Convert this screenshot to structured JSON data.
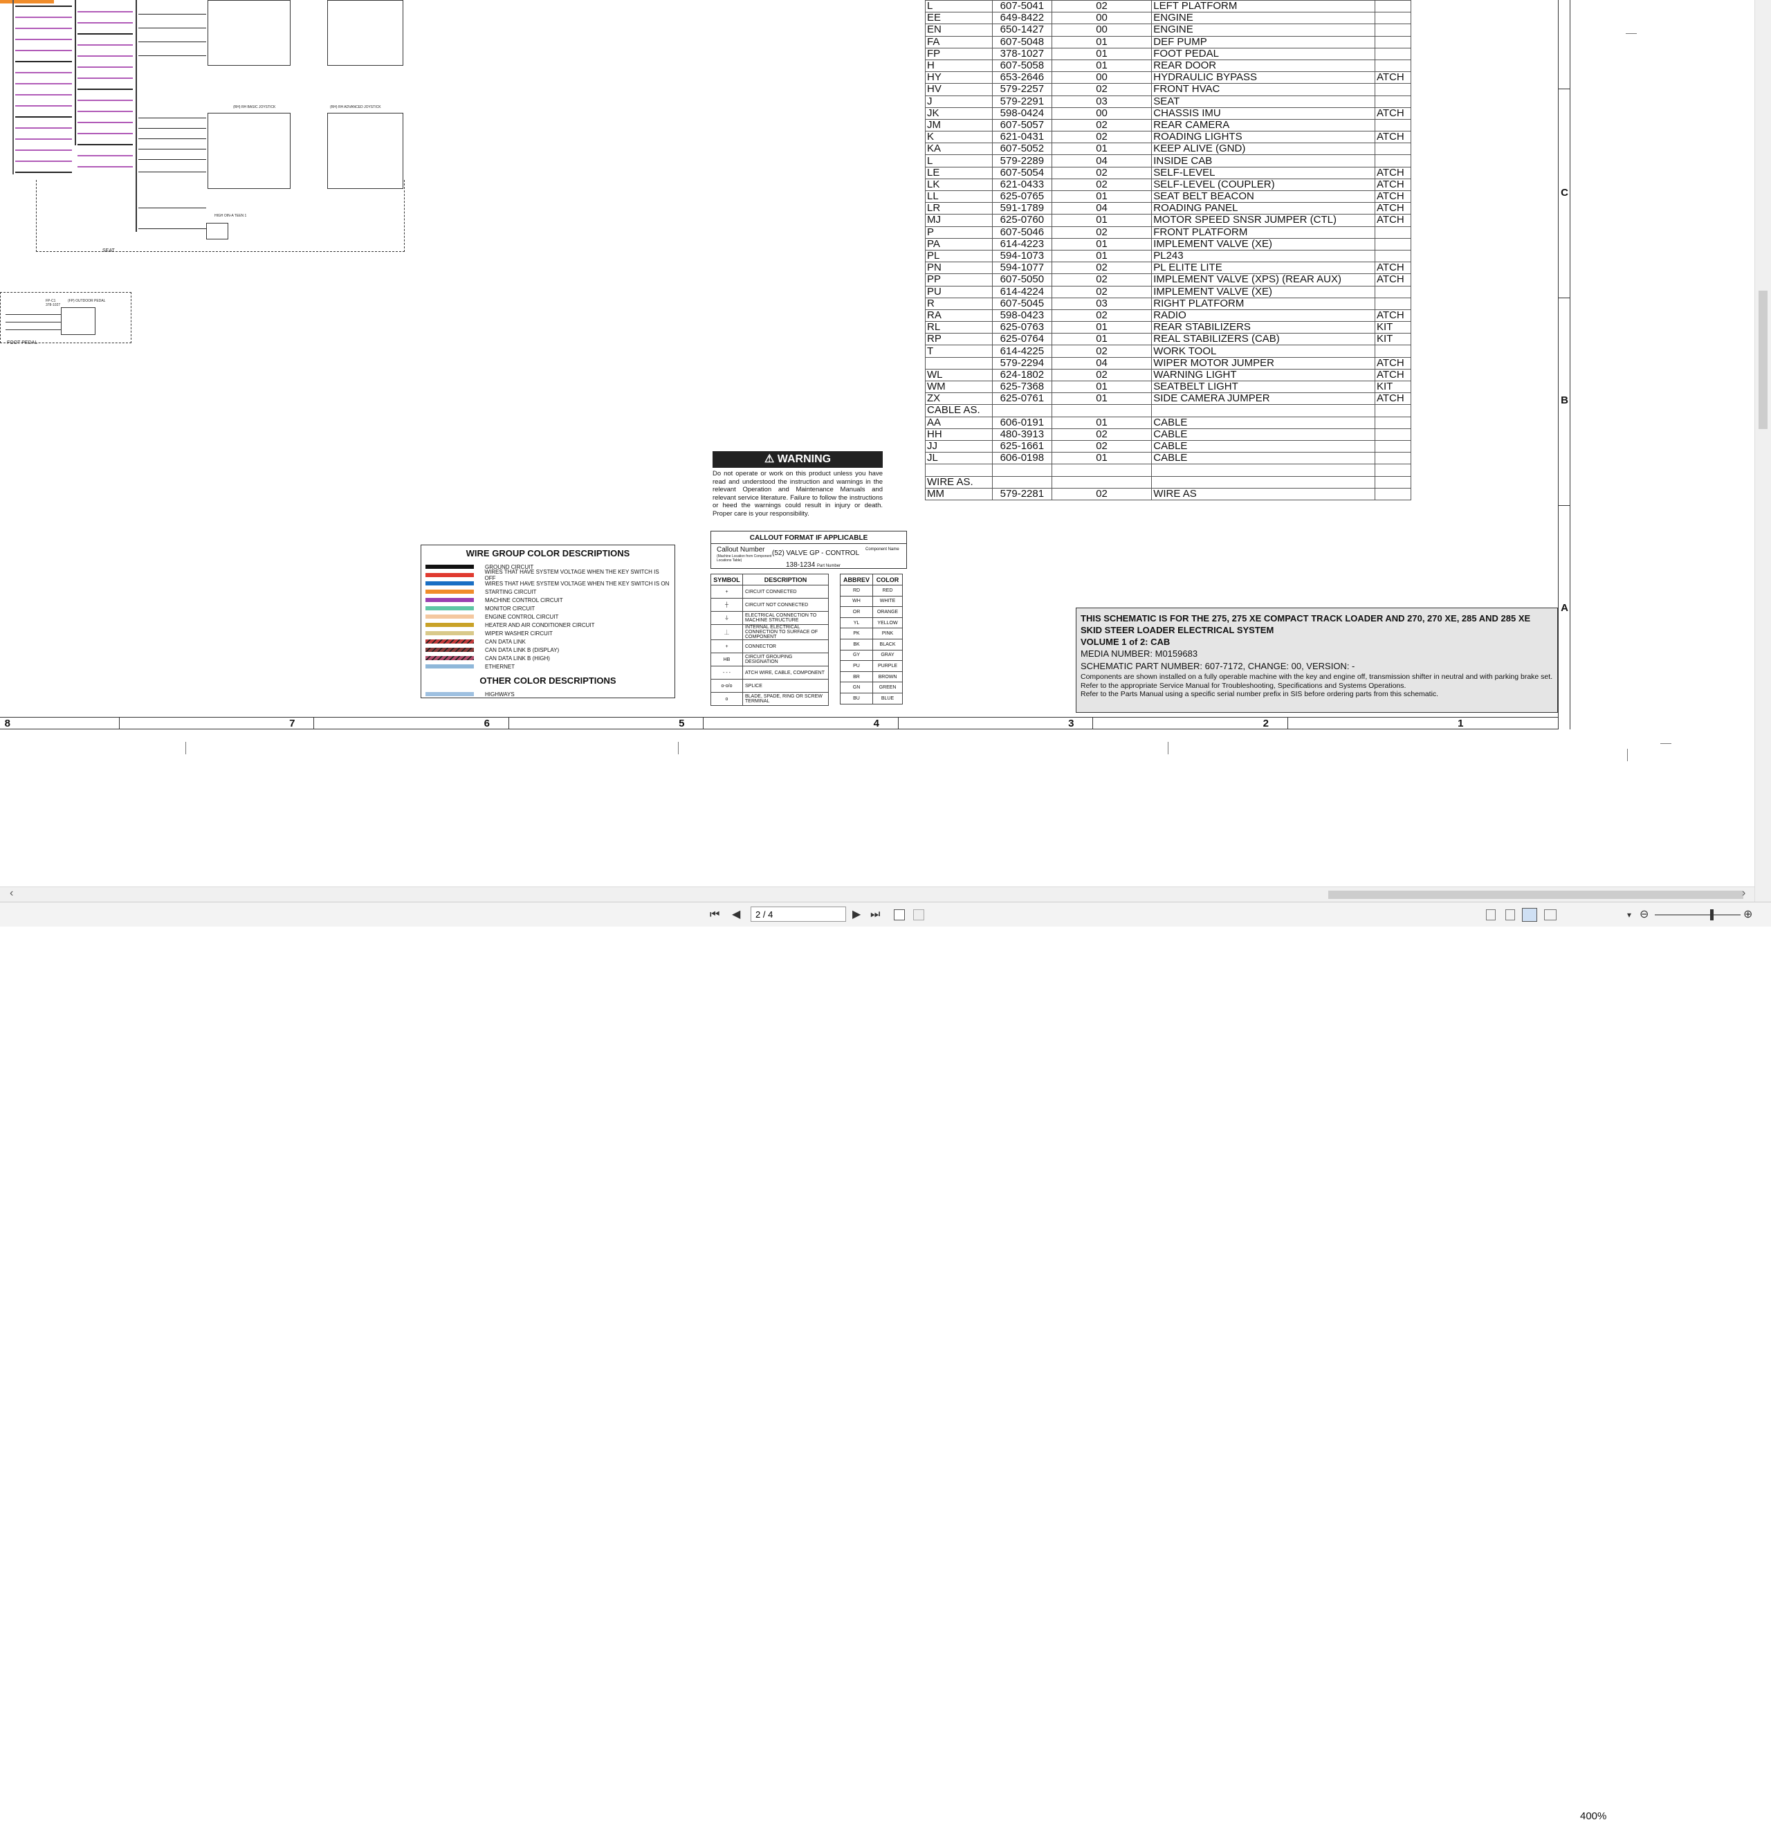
{
  "connector_table": {
    "rows": [
      [
        "L",
        "607-5041",
        "02",
        "LEFT PLATFORM",
        ""
      ],
      [
        "EE",
        "649-8422",
        "00",
        "ENGINE",
        ""
      ],
      [
        "EN",
        "650-1427",
        "00",
        "ENGINE",
        ""
      ],
      [
        "FA",
        "607-5048",
        "01",
        "DEF PUMP",
        ""
      ],
      [
        "FP",
        "378-1027",
        "01",
        "FOOT PEDAL",
        ""
      ],
      [
        "H",
        "607-5058",
        "01",
        "REAR DOOR",
        ""
      ],
      [
        "HY",
        "653-2646",
        "00",
        "HYDRAULIC BYPASS",
        "ATCH"
      ],
      [
        "HV",
        "579-2257",
        "02",
        "FRONT HVAC",
        ""
      ],
      [
        "J",
        "579-2291",
        "03",
        "SEAT",
        ""
      ],
      [
        "JK",
        "598-0424",
        "00",
        "CHASSIS IMU",
        "ATCH"
      ],
      [
        "JM",
        "607-5057",
        "02",
        "REAR CAMERA",
        ""
      ],
      [
        "K",
        "621-0431",
        "02",
        "ROADING LIGHTS",
        "ATCH"
      ],
      [
        "KA",
        "607-5052",
        "01",
        "KEEP ALIVE (GND)",
        ""
      ],
      [
        "L",
        "579-2289",
        "04",
        "INSIDE CAB",
        ""
      ],
      [
        "LE",
        "607-5054",
        "02",
        "SELF-LEVEL",
        "ATCH"
      ],
      [
        "LK",
        "621-0433",
        "02",
        "SELF-LEVEL (COUPLER)",
        "ATCH"
      ],
      [
        "LL",
        "625-0765",
        "01",
        "SEAT BELT BEACON",
        "ATCH"
      ],
      [
        "LR",
        "591-1789",
        "04",
        "ROADING PANEL",
        "ATCH"
      ],
      [
        "MJ",
        "625-0760",
        "01",
        "MOTOR SPEED SNSR JUMPER (CTL)",
        "ATCH"
      ],
      [
        "P",
        "607-5046",
        "02",
        "FRONT PLATFORM",
        ""
      ],
      [
        "PA",
        "614-4223",
        "01",
        "IMPLEMENT VALVE (XE)",
        ""
      ],
      [
        "PL",
        "594-1073",
        "01",
        "PL243",
        ""
      ],
      [
        "PN",
        "594-1077",
        "02",
        "PL ELITE LITE",
        "ATCH"
      ],
      [
        "PP",
        "607-5050",
        "02",
        "IMPLEMENT VALVE (XPS) (REAR AUX)",
        "ATCH"
      ],
      [
        "PU",
        "614-4224",
        "02",
        "IMPLEMENT VALVE (XE)",
        ""
      ],
      [
        "R",
        "607-5045",
        "03",
        "RIGHT PLATFORM",
        ""
      ],
      [
        "RA",
        "598-0423",
        "02",
        "RADIO",
        "ATCH"
      ],
      [
        "RL",
        "625-0763",
        "01",
        "REAR STABILIZERS",
        "KIT"
      ],
      [
        "RP",
        "625-0764",
        "01",
        "REAL STABILIZERS (CAB)",
        "KIT"
      ],
      [
        "T",
        "614-4225",
        "02",
        "WORK TOOL",
        ""
      ],
      [
        "",
        "579-2294",
        "04",
        "WIPER MOTOR JUMPER",
        "ATCH"
      ],
      [
        "WL",
        "624-1802",
        "02",
        "WARNING LIGHT",
        "ATCH"
      ],
      [
        "WM",
        "625-7368",
        "01",
        "SEATBELT LIGHT",
        "KIT"
      ],
      [
        "ZX",
        "625-0761",
        "01",
        "SIDE CAMERA JUMPER",
        "ATCH"
      ],
      [
        "CABLE AS.",
        "",
        "",
        "",
        ""
      ],
      [
        "AA",
        "606-0191",
        "01",
        "CABLE",
        ""
      ],
      [
        "HH",
        "480-3913",
        "02",
        "CABLE",
        ""
      ],
      [
        "JJ",
        "625-1661",
        "02",
        "CABLE",
        ""
      ],
      [
        "JL",
        "606-0198",
        "01",
        "CABLE",
        ""
      ],
      [
        "",
        "",
        "",
        "",
        ""
      ],
      [
        "WIRE AS.",
        "",
        "",
        "",
        ""
      ],
      [
        "MM",
        "579-2281",
        "02",
        "WIRE AS",
        ""
      ]
    ]
  },
  "warning": {
    "title": "WARNING",
    "text": "Do not operate or work on this product unless you have read and understood the instruction and warnings in the relevant Operation and Maintenance Manuals and relevant service literature. Failure to follow the instructions or heed the warnings could result in injury or death. Proper care is your responsibility."
  },
  "legend": {
    "title": "WIRE GROUP COLOR DESCRIPTIONS",
    "items": [
      {
        "label": "GROUND CIRCUIT",
        "color": "#111111"
      },
      {
        "label": "WIRES THAT HAVE SYSTEM VOLTAGE WHEN THE KEY SWITCH IS OFF",
        "color": "#e03a2f"
      },
      {
        "label": "WIRES THAT HAVE SYSTEM VOLTAGE WHEN THE KEY SWITCH IS ON",
        "color": "#1a6fc4"
      },
      {
        "label": "STARTING CIRCUIT",
        "color": "#f08c2a"
      },
      {
        "label": "MACHINE CONTROL CIRCUIT",
        "color": "#9b3fb0"
      },
      {
        "label": "MONITOR CIRCUIT",
        "color": "#5fc6a5"
      },
      {
        "label": "ENGINE CONTROL CIRCUIT",
        "color": "#f4c8a0"
      },
      {
        "label": "HEATER AND AIR CONDITIONER CIRCUIT",
        "color": "#c9a227"
      },
      {
        "label": "WIPER WASHER CIRCUIT",
        "color": "#d9c98a"
      },
      {
        "label": "CAN DATA LINK",
        "color": "#c43a3a"
      },
      {
        "label": "CAN DATA LINK B (DISPLAY)",
        "color": "#8a3a3a"
      },
      {
        "label": "CAN DATA LINK B (HIGH)",
        "color": "#b04c6c"
      },
      {
        "label": "ETHERNET",
        "color": "#8fb7d9"
      }
    ],
    "other_title": "OTHER COLOR DESCRIPTIONS",
    "other_items": [
      {
        "label": "HIGHWAYS",
        "color": "#9ec0e0"
      }
    ]
  },
  "callout": {
    "title": "CALLOUT FORMAT IF APPLICABLE",
    "callout_number": "Callout Number",
    "callout_note": "(Machine Location from Component Locations Table)",
    "example": "(52) VALVE GP - CONTROL",
    "component_name": "Component Name",
    "part_example": "138-1234",
    "part_number": "Part Number"
  },
  "symbols": {
    "headers": [
      "SYMBOL",
      "DESCRIPTION"
    ],
    "rows": [
      {
        "sym": "+",
        "desc": "CIRCUIT CONNECTED"
      },
      {
        "sym": "┼",
        "desc": "CIRCUIT NOT CONNECTED"
      },
      {
        "sym": "⏚",
        "desc": "ELECTRICAL CONNECTION TO MACHINE STRUCTURE"
      },
      {
        "sym": "⏊",
        "desc": "INTERNAL ELECTRICAL CONNECTION TO SURFACE OF COMPONENT"
      },
      {
        "sym": "+",
        "desc": "CONNECTOR"
      },
      {
        "sym": "HB",
        "desc": "CIRCUIT GROUPING DESIGNATION"
      },
      {
        "sym": "- - -",
        "desc": "ATCH WIRE, CABLE, COMPONENT"
      },
      {
        "sym": "o-o/o",
        "desc": "SPLICE"
      },
      {
        "sym": "o",
        "desc": "BLADE, SPADE, RING OR SCREW TERMINAL"
      }
    ]
  },
  "abbreviations": {
    "headers": [
      "ABBREV",
      "COLOR"
    ],
    "rows": [
      [
        "RD",
        "RED"
      ],
      [
        "WH",
        "WHITE"
      ],
      [
        "OR",
        "ORANGE"
      ],
      [
        "YL",
        "YELLOW"
      ],
      [
        "PK",
        "PINK"
      ],
      [
        "BK",
        "BLACK"
      ],
      [
        "GY",
        "GRAY"
      ],
      [
        "PU",
        "PURPLE"
      ],
      [
        "BR",
        "BROWN"
      ],
      [
        "GN",
        "GREEN"
      ],
      [
        "BU",
        "BLUE"
      ]
    ]
  },
  "title_block": {
    "line1": "THIS SCHEMATIC IS FOR THE 275, 275 XE COMPACT TRACK LOADER AND 270, 270 XE, 285 AND 285 XE SKID STEER LOADER ELECTRICAL SYSTEM",
    "volume": "VOLUME 1 of 2: CAB",
    "media": "MEDIA NUMBER: M0159683",
    "part": "SCHEMATIC PART NUMBER: 607-7172, CHANGE: 00, VERSION: -",
    "note1": "Components are shown installed on a fully operable machine with the key and engine off, transmission shifter in neutral and with parking brake set.",
    "note2": "Refer to the appropriate Service Manual for Troubleshooting, Specifications and Systems Operations.",
    "note3": "Refer to the Parts Manual using a specific serial number prefix in SIS before ordering parts from this schematic."
  },
  "zones": {
    "bottom": [
      "8",
      "7",
      "6",
      "5",
      "4",
      "3",
      "2",
      "1"
    ],
    "right": [
      "C",
      "B",
      "A"
    ]
  },
  "schematic_labels": {
    "seat": "SEAT",
    "foot_pedal": "FOOT PEDAL",
    "fp_c": "FP-C1",
    "fp_part": "378-1027",
    "fp_name": "(FP) OUTDOOR PEDAL",
    "joystick_basic": "(RH) RH BASIC JOYSTICK",
    "joystick_adv": "(RH) RH ADVANCED JOYSTICK",
    "seat_switch": "HIGH OIN-A TEEN 1"
  },
  "toolbar": {
    "page_value": "2 / 4",
    "zoom": "400%",
    "first_label": "⏮",
    "prev_label": "◀",
    "next_label": "▶",
    "last_label": "⏭",
    "page_dropdown": "▾",
    "zoom_out": "⊖",
    "zoom_in": "⊕",
    "zoom_dropdown": "▾"
  },
  "scroll": {
    "left_arrow": "‹",
    "right_arrow": "›"
  }
}
